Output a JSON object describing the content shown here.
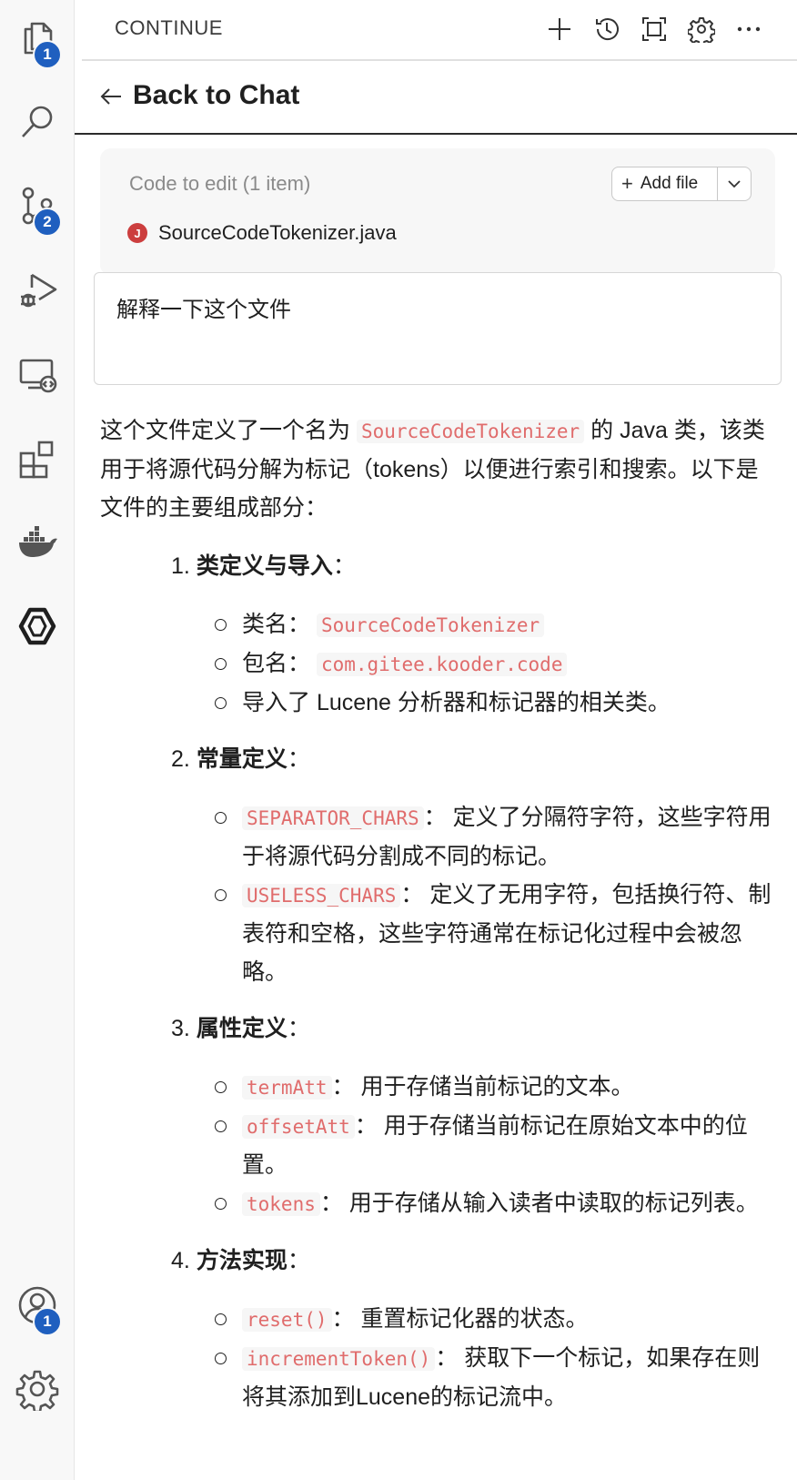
{
  "activity_bar": {
    "items": [
      {
        "name": "explorer-icon",
        "badge": "1"
      },
      {
        "name": "search-icon",
        "badge": null
      },
      {
        "name": "source-control-icon",
        "badge": "2"
      },
      {
        "name": "run-debug-icon",
        "badge": null
      },
      {
        "name": "remote-explorer-icon",
        "badge": null
      },
      {
        "name": "extensions-icon",
        "badge": null
      },
      {
        "name": "docker-icon",
        "badge": null
      },
      {
        "name": "continue-icon",
        "badge": null
      }
    ],
    "bottom": [
      {
        "name": "account-icon",
        "badge": "1"
      },
      {
        "name": "settings-gear-icon",
        "badge": null
      }
    ]
  },
  "header": {
    "title": "CONTINUE",
    "icons": [
      "plus-icon",
      "history-icon",
      "fullscreen-icon",
      "gear-icon",
      "more-icon"
    ]
  },
  "back": {
    "label": "Back to Chat"
  },
  "code_to_edit": {
    "title": "Code to edit (1 item)",
    "add_file_label": "Add file",
    "file_badge": "J",
    "file_name": "SourceCodeTokenizer.java"
  },
  "prompt": {
    "text": "解释一下这个文件"
  },
  "response": {
    "intro_1": "这个文件定义了一个名为 ",
    "intro_code": "SourceCodeTokenizer",
    "intro_2": " 的 Java 类，该类用于将源代码分解为标记（tokens）以便进行索引和搜索。以下是文件的主要组成部分：",
    "sections": [
      {
        "num": "1.",
        "title": "类定义与导入",
        "colon": "：",
        "items": [
          {
            "pre": "类名： ",
            "code": "SourceCodeTokenizer",
            "post": ""
          },
          {
            "pre": "包名： ",
            "code": "com.gitee.kooder.code",
            "post": ""
          },
          {
            "pre": "导入了 Lucene 分析器和标记器的相关类。",
            "code": "",
            "post": ""
          }
        ]
      },
      {
        "num": "2.",
        "title": "常量定义",
        "colon": "：",
        "items": [
          {
            "pre": "",
            "code": "SEPARATOR_CHARS",
            "post": "： 定义了分隔符字符，这些字符用于将源代码分割成不同的标记。"
          },
          {
            "pre": "",
            "code": "USELESS_CHARS",
            "post": "： 定义了无用字符，包括换行符、制表符和空格，这些字符通常在标记化过程中会被忽略。"
          }
        ]
      },
      {
        "num": "3.",
        "title": "属性定义",
        "colon": "：",
        "items": [
          {
            "pre": "",
            "code": "termAtt",
            "post": "： 用于存储当前标记的文本。"
          },
          {
            "pre": "",
            "code": "offsetAtt",
            "post": "： 用于存储当前标记在原始文本中的位置。"
          },
          {
            "pre": "",
            "code": "tokens",
            "post": "： 用于存储从输入读者中读取的标记列表。"
          }
        ]
      },
      {
        "num": "4.",
        "title": "方法实现",
        "colon": "：",
        "items": [
          {
            "pre": "",
            "code": "reset()",
            "post": "： 重置标记化器的状态。"
          },
          {
            "pre": "",
            "code": "incrementToken()",
            "post": "： 获取下一个标记，如果存在则将其添加到Lucene的标记流中。"
          }
        ]
      }
    ]
  }
}
